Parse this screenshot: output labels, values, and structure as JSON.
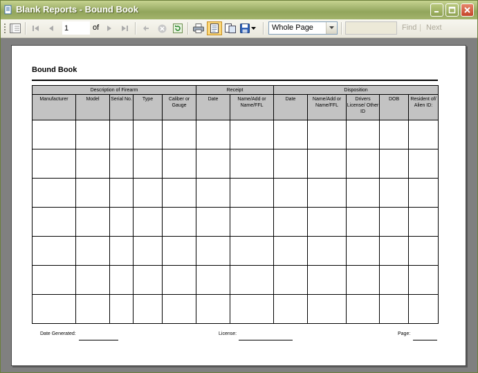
{
  "window": {
    "title": "Blank Reports - Bound Book",
    "minimize_icon": "minimize-icon",
    "maximize_icon": "maximize-icon",
    "close_icon": "close-icon"
  },
  "toolbar": {
    "page_number": "1",
    "of_label": "of",
    "zoom_value": "Whole Page",
    "find_placeholder": "",
    "find_label": "Find",
    "next_label": "Next"
  },
  "report": {
    "title": "Bound Book",
    "groups": [
      "Description of Firearm",
      "Receipt",
      "Disposition"
    ],
    "columns": [
      "Manufacturer",
      "Model",
      "Serial No.",
      "Type",
      "Caliber or Gauge",
      "Date",
      "Name/Add or Name/FFL",
      "Date",
      "Name/Add or Name/FFL",
      "Drivers License/ Other ID",
      "DOB",
      "Resident of/ Alien ID:"
    ],
    "blank_rows": 7,
    "footer": {
      "date_generated": "Date Generated:",
      "license": "License:",
      "page": "Page:"
    }
  },
  "colors": {
    "titlebar": "#a7b873",
    "header_fill": "#c3c3c3",
    "canvas": "#808080"
  }
}
